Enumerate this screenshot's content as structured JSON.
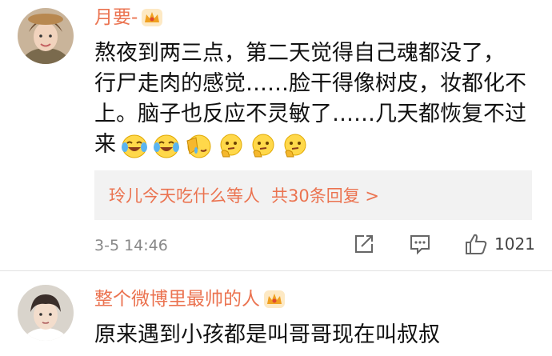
{
  "comment1": {
    "username": "月要-",
    "lines": [
      "熬夜到两三点，第二天觉得自己魂都没了，",
      "行尸走肉的感觉……脸干得像树皮，妆都化不",
      "上。脑子也反应不灵敏了……几天都恢复不过",
      "来"
    ],
    "emojis": [
      "crying-laughing-emoji",
      "crying-laughing-emoji",
      "facepalm-emoji",
      "thinking-emoji",
      "thinking-emoji",
      "thinking-emoji"
    ],
    "reply_user": "玲儿今天吃什么等人",
    "reply_summary": "共30条回复 >",
    "timestamp": "3-5 14:46",
    "like_count": "1021"
  },
  "comment2": {
    "username": "整个微博里最帅的人",
    "text": "原来遇到小孩都是叫哥哥现在叫叔叔"
  },
  "colors": {
    "username": "#eb7350",
    "text": "#111111",
    "meta": "#888888",
    "reply_bg": "#f2f2f2",
    "crown": "#f0a020"
  }
}
